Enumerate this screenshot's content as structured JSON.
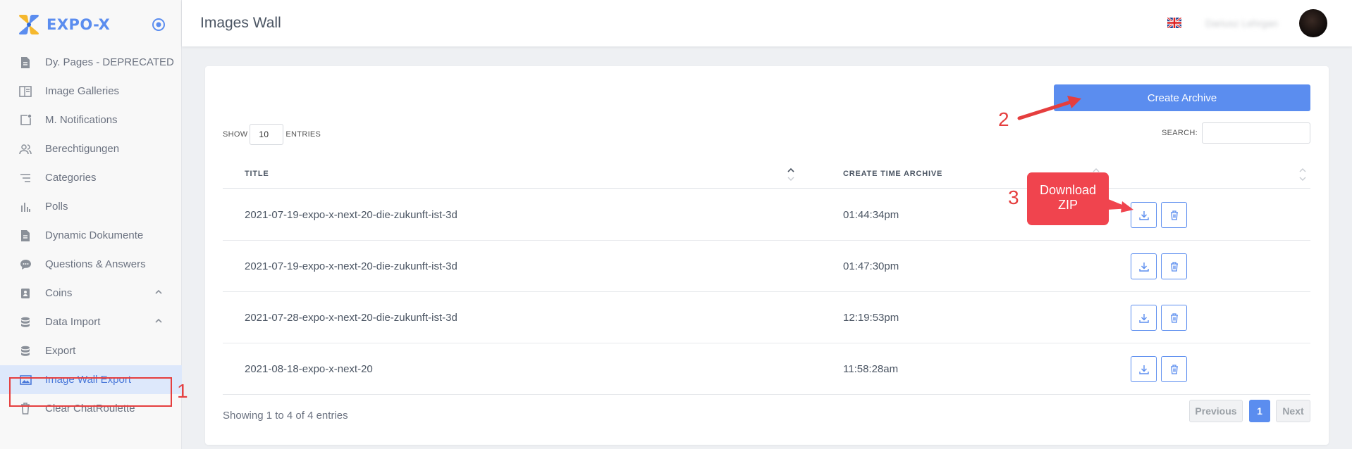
{
  "brand": {
    "name": "EXPO-X"
  },
  "sidebar": {
    "items": [
      {
        "label": "Dy. Pages - DEPRECATED",
        "icon": "document-icon"
      },
      {
        "label": "Image Galleries",
        "icon": "gallery-icon"
      },
      {
        "label": "M. Notifications",
        "icon": "notification-icon"
      },
      {
        "label": "Berechtigungen",
        "icon": "users-icon"
      },
      {
        "label": "Categories",
        "icon": "list-icon"
      },
      {
        "label": "Polls",
        "icon": "bar-chart-icon"
      },
      {
        "label": "Dynamic Dokumente",
        "icon": "document-icon"
      },
      {
        "label": "Questions & Answers",
        "icon": "chat-icon"
      },
      {
        "label": "Coins",
        "icon": "coin-icon",
        "expandable": true
      },
      {
        "label": "Data Import",
        "icon": "database-icon",
        "expandable": true
      },
      {
        "label": "Export",
        "icon": "database-icon"
      },
      {
        "label": "Image Wall Export",
        "icon": "image-icon",
        "active": true
      },
      {
        "label": "Clear ChatRoulette",
        "icon": "trash-icon"
      }
    ]
  },
  "header": {
    "title": "Images Wall",
    "language": "en-GB"
  },
  "toolbar": {
    "create_label": "Create Archive"
  },
  "table_controls": {
    "show_label": "SHOW",
    "entries_value": "10",
    "entries_label": "ENTRIES",
    "search_label": "SEARCH:",
    "search_value": ""
  },
  "table": {
    "columns": [
      "TITLE",
      "CREATE TIME ARCHIVE"
    ],
    "rows": [
      {
        "title": "2021-07-19-expo-x-next-20-die-zukunft-ist-3d",
        "time": "01:44:34pm"
      },
      {
        "title": "2021-07-19-expo-x-next-20-die-zukunft-ist-3d",
        "time": "01:47:30pm"
      },
      {
        "title": "2021-07-28-expo-x-next-20-die-zukunft-ist-3d",
        "time": "12:19:53pm"
      },
      {
        "title": "2021-08-18-expo-x-next-20",
        "time": "11:58:28am"
      }
    ]
  },
  "footer": {
    "info": "Showing 1 to 4 of 4 entries"
  },
  "pagination": {
    "previous": "Previous",
    "current": "1",
    "next": "Next"
  },
  "annotations": {
    "step1": "1",
    "step2": "2",
    "step3": "3",
    "callout_line1": "Download",
    "callout_line2": "ZIP",
    "color": "#e53e3e"
  },
  "colors": {
    "accent": "#5b8def",
    "active_bg": "#dde8fb"
  }
}
